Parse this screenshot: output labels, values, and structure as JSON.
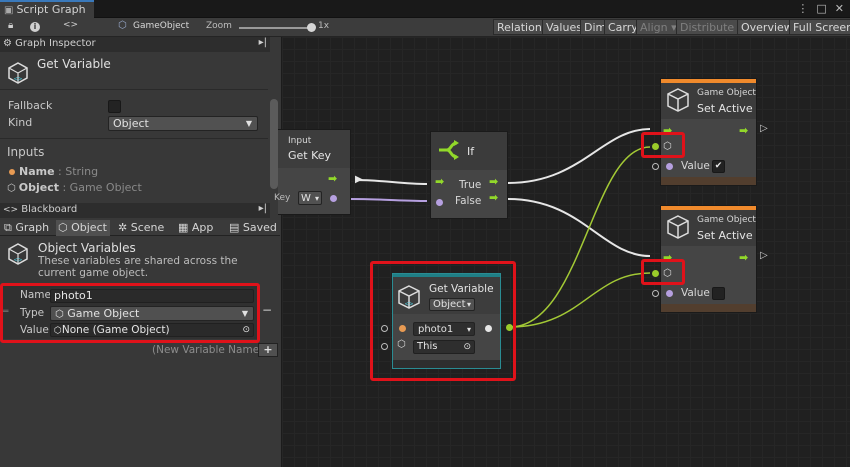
{
  "window": {
    "tab_title": "Script Graph",
    "controls": [
      "⋮",
      "□",
      "✕"
    ]
  },
  "toolbar": {
    "lock_icon": "lock-icon",
    "info_icon": "info-icon",
    "code_icon": "<>",
    "object_label": "GameObject",
    "zoom_label": "Zoom",
    "zoom_value": "1x",
    "zoom_level": 1,
    "buttons": [
      "Relations",
      "Values",
      "Dim",
      "Carry",
      "Align ▾",
      "Distribute ▾",
      "Overview",
      "Full Screen"
    ]
  },
  "inspector": {
    "header": "Graph Inspector",
    "node_title": "Get Variable",
    "fallback_label": "Fallback",
    "kind_label": "Kind",
    "kind_value": "Object",
    "inputs_title": "Inputs",
    "input_name_label": "Name",
    "input_name_type": " : String",
    "input_object_label": "Object",
    "input_object_type": " : Game Object"
  },
  "blackboard": {
    "header": "Blackboard",
    "tabs": [
      "Graph",
      "Object",
      "Scene",
      "App",
      "Saved"
    ],
    "title": "Object Variables",
    "description": "These variables are shared across the current game object.",
    "name_label": "Name",
    "name_value": "photo1",
    "type_label": "Type",
    "type_value": "Game Object",
    "value_label": "Value",
    "value_value": "None (Game Object)",
    "new_variable_placeholder": "(New Variable Name)",
    "add_label": "+",
    "remove_label": "−"
  },
  "nodes": {
    "getkey": {
      "subtitle": "Input",
      "title": "Get Key",
      "key_label": "Key",
      "key_value": "W"
    },
    "if": {
      "title": "If",
      "true_label": "True",
      "false_label": "False"
    },
    "setactive1": {
      "subtitle": "Game Object",
      "title": "Set Active",
      "value_label": "Value",
      "checked": true,
      "check_mark": "✔"
    },
    "setactive2": {
      "subtitle": "Game Object",
      "title": "Set Active",
      "value_label": "Value",
      "checked": false
    },
    "getvar": {
      "title": "Get Variable",
      "kind": "Object",
      "name_value": "photo1",
      "target_value": "This"
    }
  },
  "colors": {
    "accent_orange": "#f08a2c",
    "flow_green": "#92d82a",
    "value_wire": "#a3c935",
    "highlight_red": "#e0121a",
    "teal_header": "#1f7f86"
  }
}
